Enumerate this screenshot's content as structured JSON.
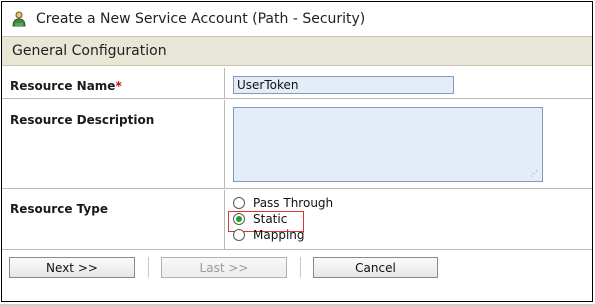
{
  "window": {
    "title": "Create a New Service Account (Path - Security)",
    "icon": "user-account-icon"
  },
  "section": {
    "title": "General Configuration"
  },
  "form": {
    "resource_name": {
      "label": "Resource Name",
      "required_marker": "*",
      "value": "UserToken"
    },
    "resource_description": {
      "label": "Resource Description",
      "value": ""
    },
    "resource_type": {
      "label": "Resource Type",
      "options": [
        {
          "label": "Pass Through",
          "selected": false
        },
        {
          "label": "Static",
          "selected": true
        },
        {
          "label": "Mapping",
          "selected": false
        }
      ]
    }
  },
  "buttons": {
    "next": "Next >>",
    "last": "Last >>",
    "cancel": "Cancel"
  },
  "colors": {
    "section_bg": "#e8e6d6",
    "input_bg": "#e3ecf7",
    "highlight": "#e03030",
    "required": "#cc0000"
  }
}
